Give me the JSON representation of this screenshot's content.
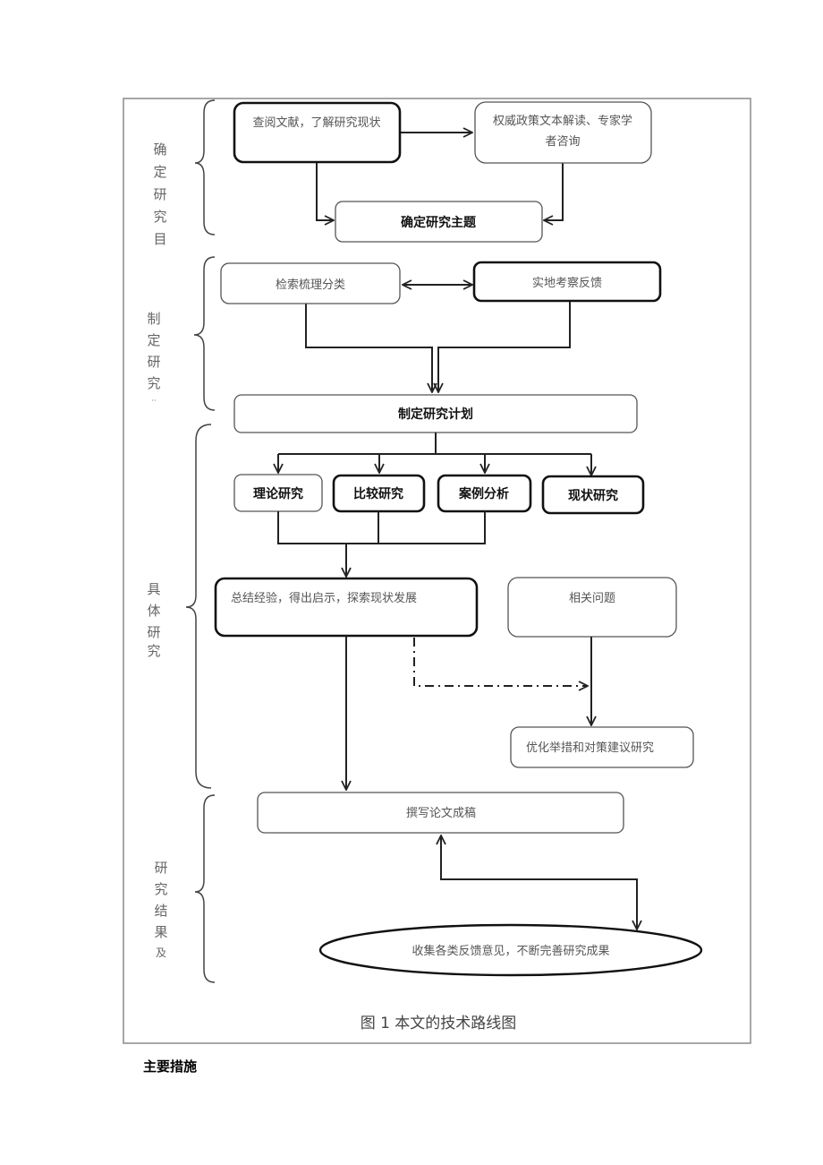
{
  "figure": {
    "caption": "图 1 本文的技术路线图",
    "phases": [
      {
        "id": "phase1",
        "label": "确定研究目",
        "chars": [
          "确",
          "定",
          "研",
          "究",
          "目"
        ]
      },
      {
        "id": "phase2",
        "label": "制定研究",
        "chars": [
          "制",
          "定",
          "研",
          "究",
          "··"
        ]
      },
      {
        "id": "phase3",
        "label": "具体研究",
        "chars": [
          "具",
          "体",
          "研",
          "究"
        ]
      },
      {
        "id": "phase4",
        "label": "研究结果及",
        "chars": [
          "研",
          "究",
          "结",
          "果",
          "及"
        ]
      }
    ],
    "nodes": {
      "review_literature": "查阅文献，了解研究现状",
      "policy_expert_line1": "权威政策文本解读、专家学",
      "policy_expert_line2": "者咨询",
      "define_topic": "确定研究主题",
      "search_classify": "检索梳理分类",
      "field_survey": "实地考察反馈",
      "make_plan": "制定研究计划",
      "theory_research": "理论研究",
      "comparative_research": "比较研究",
      "case_analysis": "案例分析",
      "status_research": "现状研究",
      "summarize": "总结经验，得出启示，探索现状发展",
      "related_issues": "相关问题",
      "optimize": "优化举措和对策建议研究",
      "write_paper": "撰写论文成稿",
      "collect_feedback": "收集各类反馈意见，不断完善研究成果"
    },
    "edges": [
      {
        "from": "review_literature",
        "to": "policy_expert",
        "style": "solid"
      },
      {
        "from": "review_literature",
        "to": "define_topic",
        "style": "solid"
      },
      {
        "from": "policy_expert",
        "to": "define_topic",
        "style": "solid"
      },
      {
        "from": "search_classify",
        "to": "field_survey",
        "style": "bidirectional"
      },
      {
        "from": "search_classify",
        "to": "make_plan",
        "style": "solid"
      },
      {
        "from": "field_survey",
        "to": "make_plan",
        "style": "solid"
      },
      {
        "from": "make_plan",
        "to": "theory_research",
        "style": "solid"
      },
      {
        "from": "make_plan",
        "to": "comparative_research",
        "style": "solid"
      },
      {
        "from": "make_plan",
        "to": "case_analysis",
        "style": "solid"
      },
      {
        "from": "make_plan",
        "to": "status_research",
        "style": "solid"
      },
      {
        "from": "theory_research",
        "to": "summarize",
        "style": "solid"
      },
      {
        "from": "comparative_research",
        "to": "summarize",
        "style": "solid"
      },
      {
        "from": "case_analysis",
        "to": "summarize",
        "style": "solid"
      },
      {
        "from": "summarize",
        "to": "optimize",
        "style": "dash-dot"
      },
      {
        "from": "related_issues",
        "to": "optimize",
        "style": "solid"
      },
      {
        "from": "summarize",
        "to": "write_paper",
        "style": "solid"
      },
      {
        "from": "write_paper",
        "to": "collect_feedback",
        "style": "bidirectional"
      }
    ]
  },
  "document": {
    "section_heading": "主要措施"
  }
}
